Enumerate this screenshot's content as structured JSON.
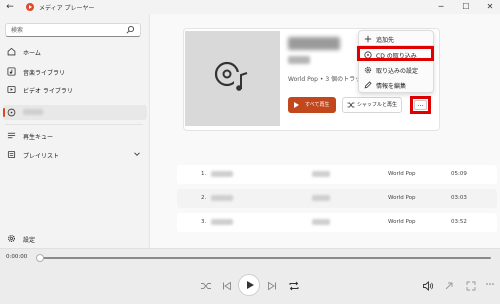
{
  "app": {
    "title": "メディア プレーヤー"
  },
  "search": {
    "placeholder": "検索"
  },
  "sidebar": {
    "items": [
      {
        "label": "ホーム"
      },
      {
        "label": "音楽ライブラリ"
      },
      {
        "label": "ビデオ ライブラリ"
      },
      {
        "label": ""
      },
      {
        "label": "再生キュー"
      },
      {
        "label": "プレイリスト"
      }
    ],
    "settings_label": "設定"
  },
  "album": {
    "meta": "World Pop • 3 個のトラック",
    "play_all_label": "すべて再生",
    "shuffle_label": "シャッフルと再生",
    "more_label": "..."
  },
  "context_menu": {
    "items": [
      {
        "label": "追加先",
        "icon": "plus-icon"
      },
      {
        "label": "CD の取り込み",
        "icon": "cd-rip-icon"
      },
      {
        "label": "取り込みの設定",
        "icon": "gear-icon"
      },
      {
        "label": "情報を編集",
        "icon": "pencil-icon"
      }
    ]
  },
  "tracks": [
    {
      "number": "1.",
      "genre": "World Pop",
      "duration": "05:09"
    },
    {
      "number": "2.",
      "genre": "World Pop",
      "duration": "03:03"
    },
    {
      "number": "3.",
      "genre": "World Pop",
      "duration": "03:52"
    }
  ],
  "player": {
    "elapsed": "0:00:00",
    "progress": 0
  },
  "colors": {
    "accent": "#c3471d",
    "highlight": "#e00000",
    "sidebar_indicator": "#d94a22"
  }
}
